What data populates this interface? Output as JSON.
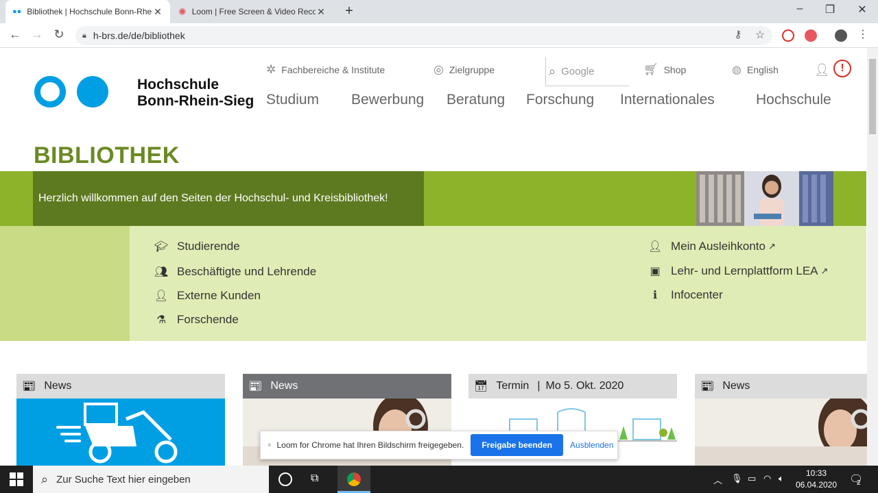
{
  "browser": {
    "tabs": [
      {
        "title": "Bibliothek | Hochschule Bonn-Rhein-Sieg",
        "active": true
      },
      {
        "title": "Loom | Free Screen & Video Recording",
        "active": false
      }
    ],
    "new_tab": "+",
    "window_controls": {
      "minimize": "–",
      "maximize": "❐",
      "close": "✕"
    },
    "url": "h-brs.de/de/bibliothek"
  },
  "header": {
    "brand_line1": "Hochschule",
    "brand_line2": "Bonn-Rhein-Sieg",
    "meta": {
      "fachbereiche": "Fachbereiche & Institute",
      "zielgruppe": "Zielgruppe",
      "search_placeholder": "Google",
      "shop": "Shop",
      "english": "English"
    },
    "nav": [
      "Studium",
      "Bewerbung",
      "Beratung",
      "Forschung",
      "Internationales",
      "Hochschule"
    ]
  },
  "page": {
    "title": "BIBLIOTHEK",
    "welcome": "Herzlich willkommen auf den Seiten der Hochschul- und Kreisbibliothek!"
  },
  "quick_links": {
    "left": [
      "Studierende",
      "Beschäftigte und Lehrende",
      "Externe Kunden",
      "Forschende"
    ],
    "right": [
      "Mein Ausleihkonto",
      "Lehr- und Lernplattform LEA",
      "Infocenter"
    ]
  },
  "cards": [
    {
      "label": "News"
    },
    {
      "label": "News"
    },
    {
      "label": "Termin",
      "date": "Mo 5. Okt. 2020"
    },
    {
      "label": "News"
    }
  ],
  "loom_bar": {
    "message": "Loom for Chrome hat Ihren Bildschirm freigegeben.",
    "stop": "Freigabe beenden",
    "hide": "Ausblenden"
  },
  "taskbar": {
    "search_placeholder": "Zur Suche Text hier eingeben",
    "time": "10:33",
    "date": "06.04.2020",
    "notifications": "2"
  },
  "colors": {
    "brand_blue": "#009fe3",
    "olive": "#6b8a23",
    "green": "#8db32b",
    "light_green": "#e0ecb5"
  }
}
